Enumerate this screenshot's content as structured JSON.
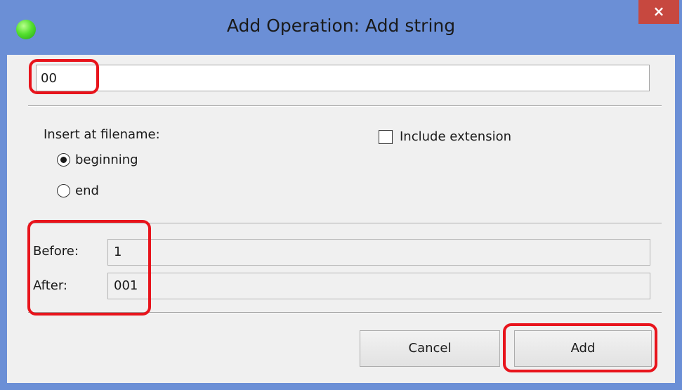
{
  "window": {
    "title": "Add Operation: Add string",
    "close_label": "×"
  },
  "string_input": {
    "value": "00"
  },
  "insert": {
    "label": "Insert at filename:",
    "options": [
      {
        "label": "beginning",
        "checked": true
      },
      {
        "label": "end",
        "checked": false
      }
    ]
  },
  "include_extension": {
    "label": "Include extension",
    "checked": false
  },
  "preview": {
    "before_label": "Before:",
    "before_value": "1",
    "after_label": "After:",
    "after_value": "001"
  },
  "buttons": {
    "cancel": "Cancel",
    "add": "Add"
  },
  "colors": {
    "titlebar": "#6b8fd6",
    "close_button": "#c7483f",
    "highlight": "#e8141c",
    "status_dot": "#3cc820"
  }
}
